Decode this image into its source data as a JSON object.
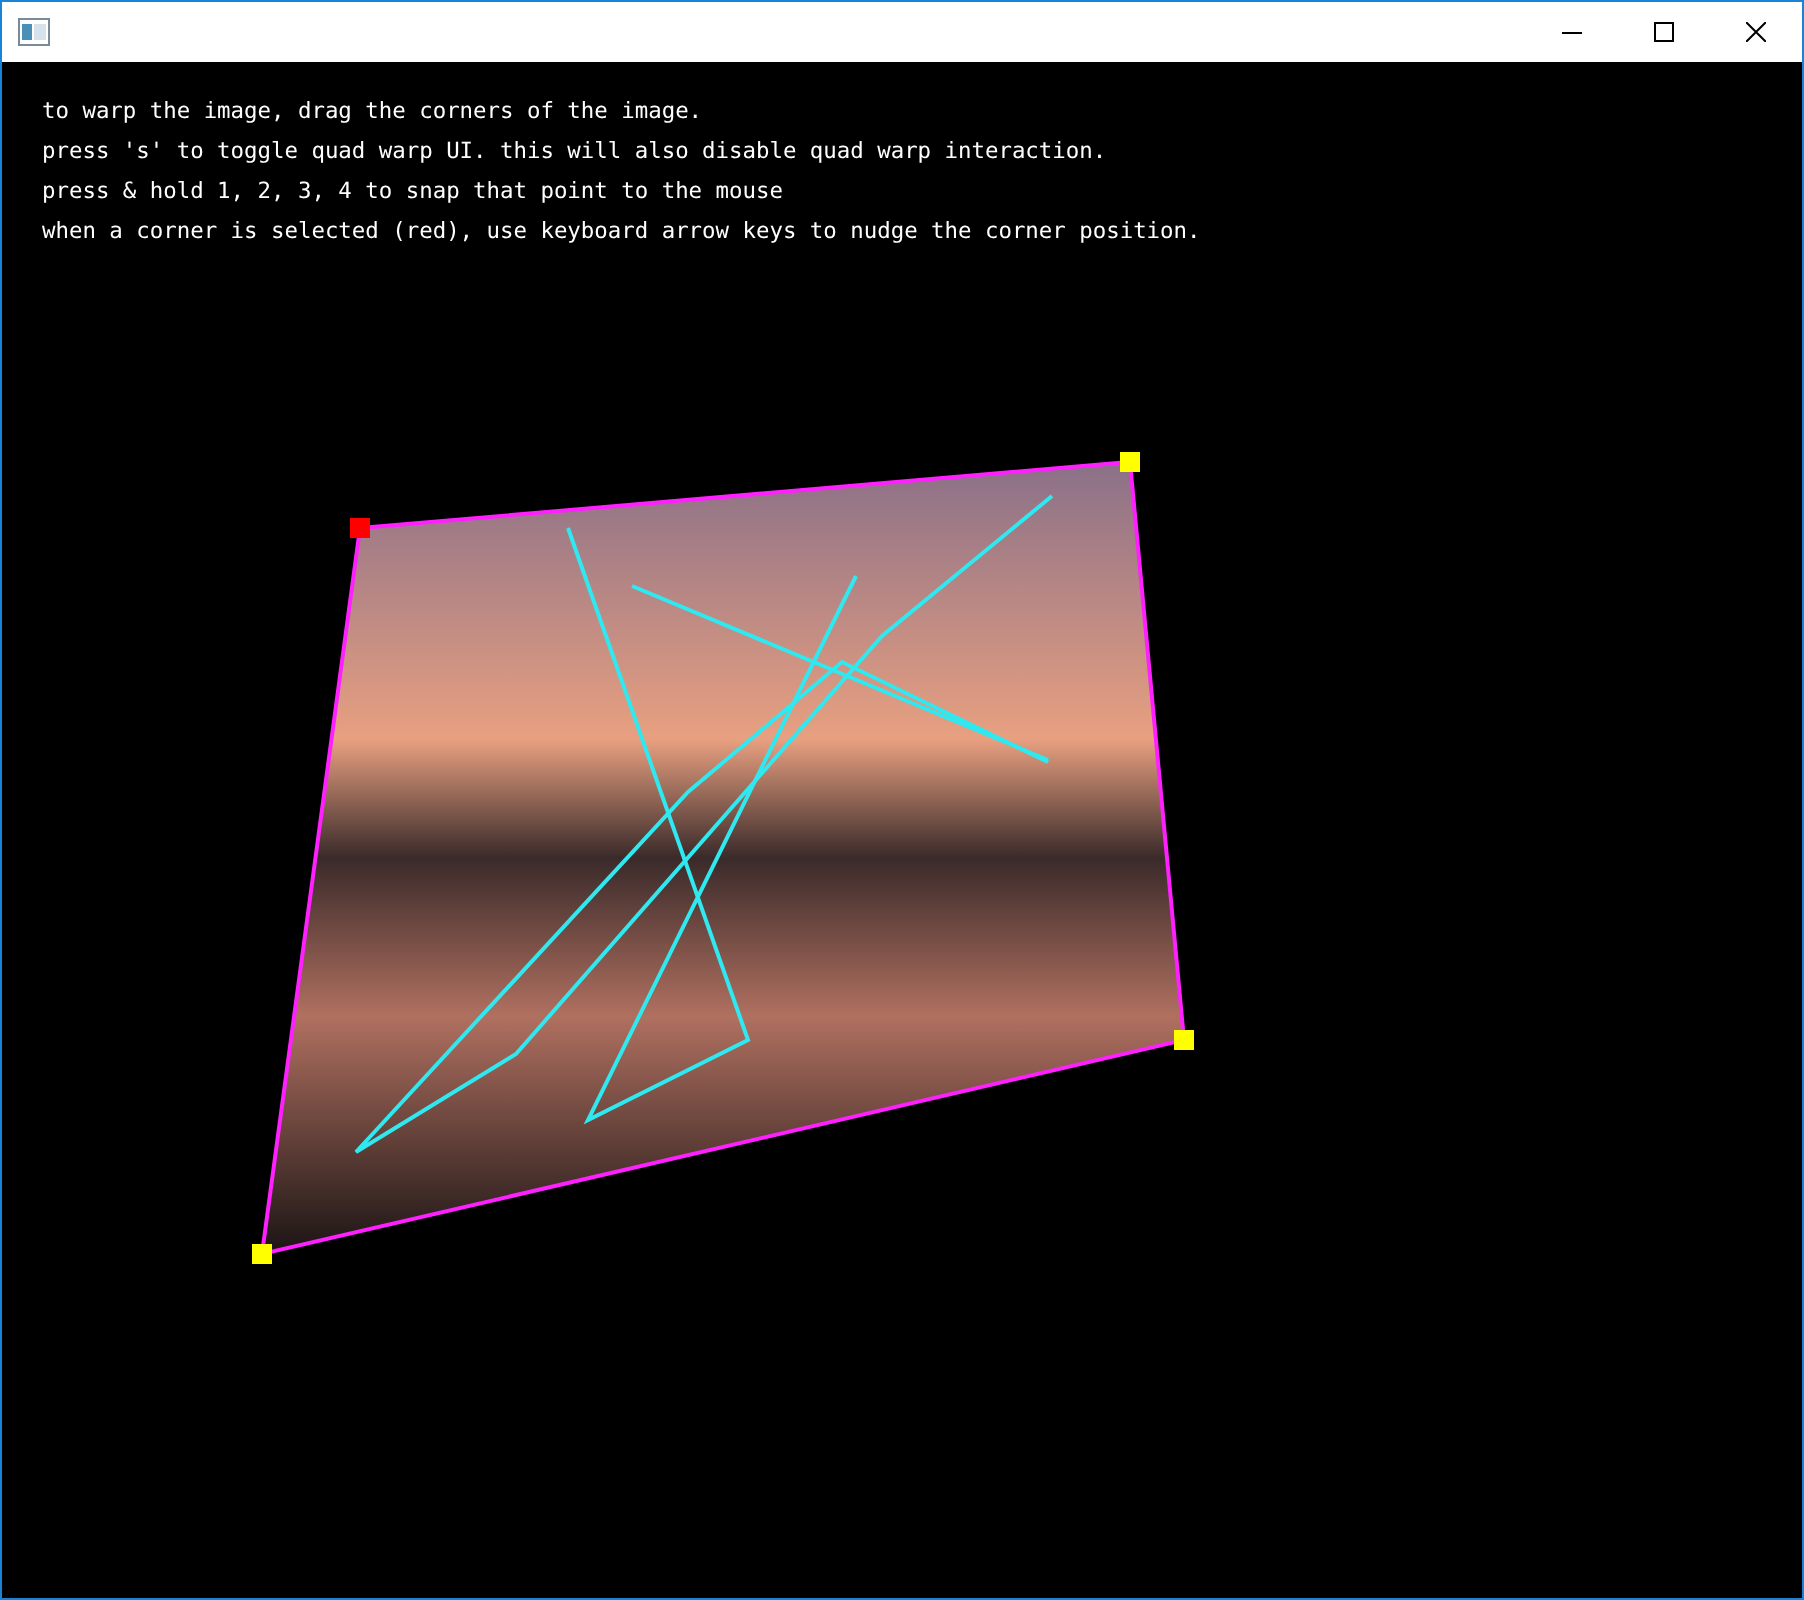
{
  "instructions": [
    "to warp the image, drag the corners of the image.",
    "press 's' to toggle quad warp UI. this will also disable quad warp interaction.",
    "press & hold 1, 2, 3, 4 to snap that point to the mouse",
    "when a corner is selected (red), use keyboard arrow keys to nudge the corner position."
  ],
  "corners": [
    {
      "selected": true
    },
    {
      "selected": false
    },
    {
      "selected": false
    },
    {
      "selected": false
    }
  ]
}
